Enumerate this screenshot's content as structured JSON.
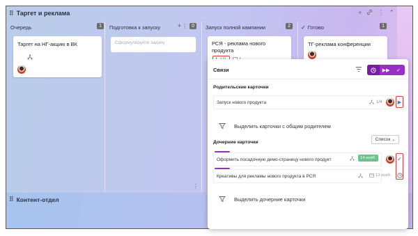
{
  "board": {
    "title": "Таргет и реклама",
    "columns": [
      {
        "title": "Очередь",
        "count": "1"
      },
      {
        "title": "Подготовка к запуску",
        "count": "0"
      },
      {
        "title": "Запуск полной кампании",
        "count": "2"
      },
      {
        "title": "Готово",
        "count": "1"
      }
    ],
    "queue_card": {
      "title": "Таргет на НГ-акцию в ВК"
    },
    "prep_placeholder": "Сформулируйте задачу",
    "launch_card": {
      "title": "РСЯ - реклама нового продукта",
      "subtasks": "1/2",
      "comments": "1"
    },
    "done_card": {
      "title": "ТГ-реклама конференции"
    },
    "lower_title": "Контент-отдел"
  },
  "popup": {
    "title": "Связи",
    "parent_section": "Родительские карточки",
    "parent_card": {
      "title": "Запуск нового продукта",
      "subtasks": "1/4"
    },
    "select_common_parent": "Выделить карточки с общим родителем",
    "child_section": "Дочерние карточки",
    "list_select": "Список",
    "child_cards": [
      {
        "title": "Оформить посадочную демо-страницу нового продукт",
        "date": "14 нояб."
      },
      {
        "title": "Креативы для рекламы нового продукта в РСЯ",
        "date": "13 нояб."
      }
    ],
    "select_children": "Выделить дочерние карточки"
  },
  "colors": {
    "accent": "#9b2ec8",
    "highlight": "#e53935",
    "date_badge": "#6dc28a",
    "count_badge": "#6b6b6b"
  }
}
